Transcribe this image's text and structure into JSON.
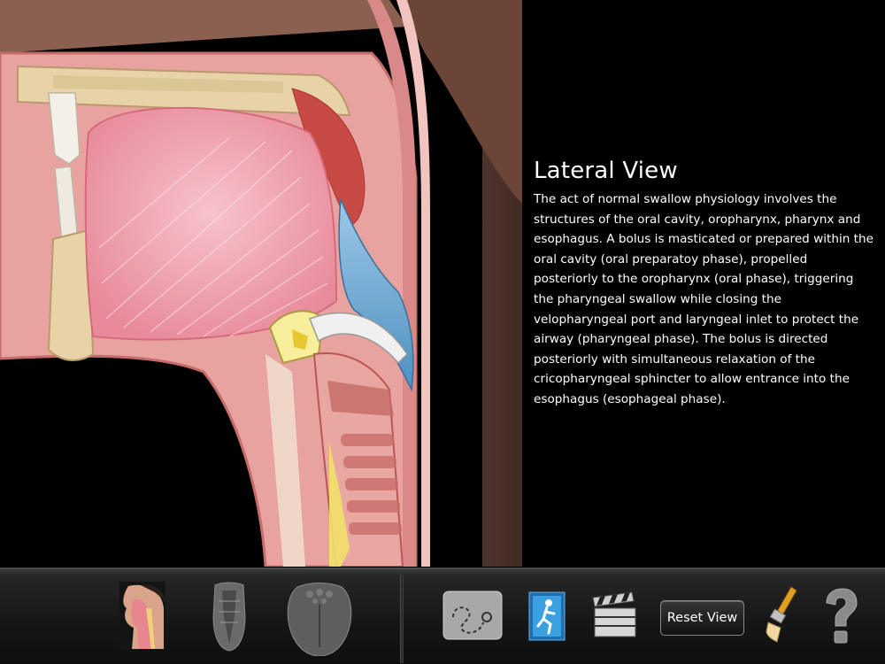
{
  "info": {
    "title": "Lateral View",
    "description": "The act of normal swallow physiology involves the structures of the oral cavity, oropharynx, pharynx and esophagus.  A bolus is masticated or prepared within the oral cavity (oral preparatoy phase), propelled posteriorly to the oropharynx (oral phase), triggering the pharyngeal swallow while closing the velopharyngeal port and laryngeal inlet to protect the airway (pharyngeal phase). The bolus is directed posteriorly with simultaneous relaxation of the cricopharyngeal sphincter to allow entrance into the esophagus (esophageal phase)."
  },
  "toolbar": {
    "view_buttons": [
      "lateral-view-thumbnail",
      "larynx-view-thumbnail",
      "tongue-view-thumbnail"
    ],
    "tools": [
      "draw-path-icon",
      "exercise-icon",
      "movie-clapper-icon",
      "paintbrush-icon",
      "help-icon"
    ],
    "reset_label": "Reset View"
  },
  "colors": {
    "background": "#000000",
    "flesh": "#e8a3a0",
    "tongue": "#f2a9b4",
    "bone": "#e8d3a8",
    "bolus": "#7ab4d9"
  }
}
